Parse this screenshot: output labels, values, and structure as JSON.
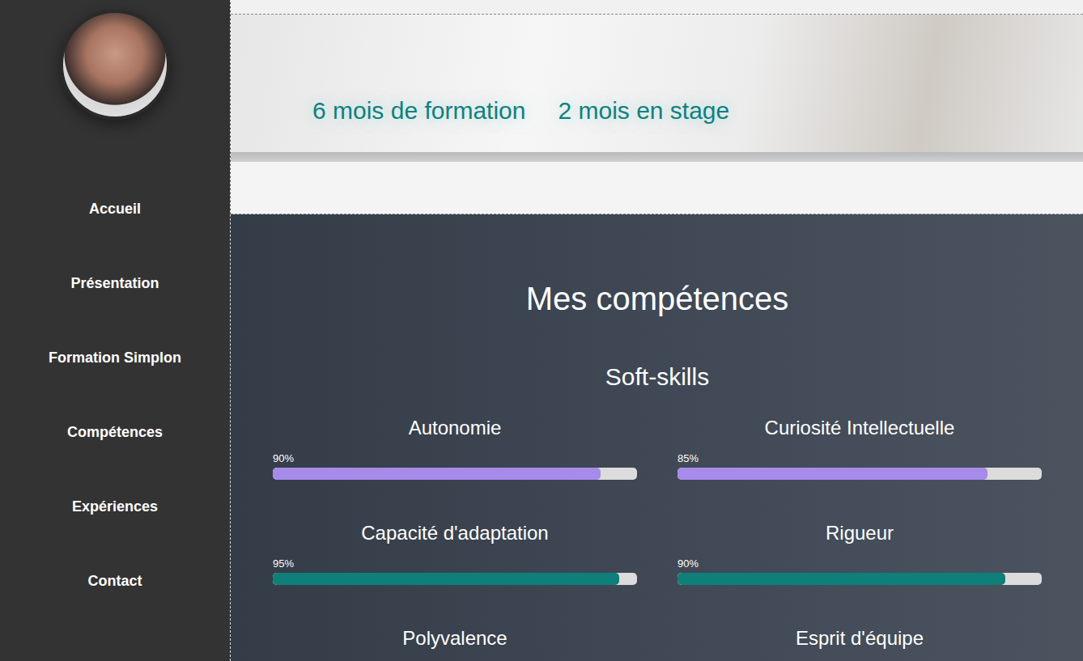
{
  "sidebar": {
    "items": [
      {
        "label": "Accueil"
      },
      {
        "label": "Présentation"
      },
      {
        "label": "Formation Simplon"
      },
      {
        "label": "Compétences"
      },
      {
        "label": "Expériences"
      },
      {
        "label": "Contact"
      }
    ]
  },
  "hero": {
    "stats": [
      "6 mois de formation",
      "2 mois en stage"
    ]
  },
  "skills": {
    "title": "Mes compétences",
    "groups": [
      {
        "title": "Soft-skills",
        "items": [
          {
            "name": "Autonomie",
            "reading": "90%",
            "level": 0.9,
            "color": "#a78bea"
          },
          {
            "name": "Curiosité Intellectuelle",
            "reading": "85%",
            "level": 0.85,
            "color": "#a78bea"
          },
          {
            "name": "Capacité d'adaptation",
            "reading": "95%",
            "level": 0.95,
            "color": "#0f7f7a"
          },
          {
            "name": "Rigueur",
            "reading": "90%",
            "level": 0.9,
            "color": "#0f7f7a"
          },
          {
            "name": "Polyvalence"
          },
          {
            "name": "Esprit d'équipe"
          }
        ]
      }
    ]
  }
}
